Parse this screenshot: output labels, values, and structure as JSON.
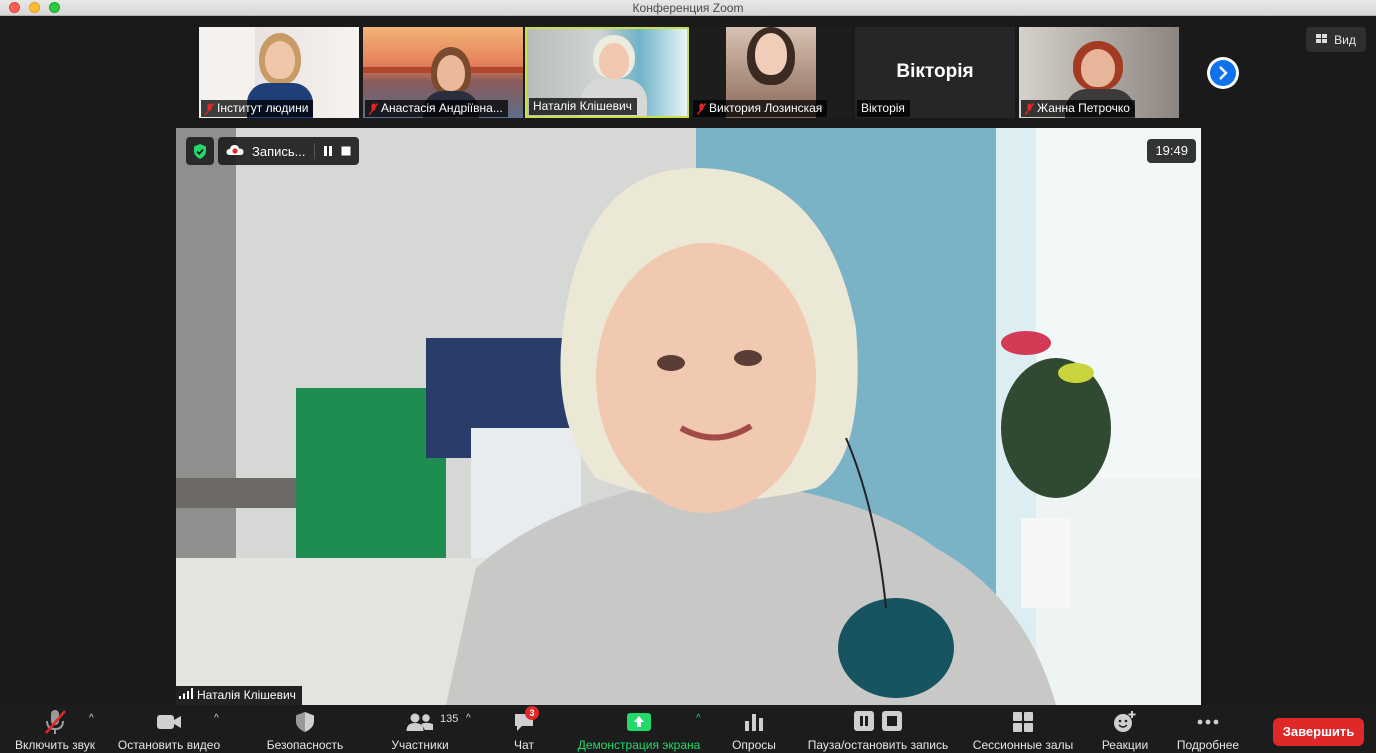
{
  "window": {
    "title": "Конференция Zoom"
  },
  "view_button": {
    "label": "Вид"
  },
  "participants_strip": [
    {
      "name": "Інститут людини",
      "muted": true
    },
    {
      "name": "Анастасія Андріївна...",
      "muted": true
    },
    {
      "name": "Наталія Клішевич",
      "muted": false,
      "active": true
    },
    {
      "name": "Виктория Лозинская",
      "muted": true
    },
    {
      "name": "Вікторія",
      "muted": false,
      "display_text": "Вікторія"
    },
    {
      "name": "Жанна Петрочко",
      "muted": true
    }
  ],
  "main_video": {
    "recording_label": "Запись...",
    "clock": "19:49",
    "speaker_name": "Наталія Клішевич"
  },
  "toolbar": {
    "audio_label": "Включить звук",
    "video_label": "Остановить видео",
    "security_label": "Безопасность",
    "participants_label": "Участники",
    "participants_count": "135",
    "chat_label": "Чат",
    "chat_badge": "3",
    "share_label": "Демонстрация экрана",
    "polls_label": "Опросы",
    "record_label": "Пауза/остановить запись",
    "breakout_label": "Сессионные залы",
    "reactions_label": "Реакции",
    "more_label": "Подробнее",
    "end_label": "Завершить"
  },
  "colors": {
    "accent_blue": "#0e72ed",
    "share_green": "#23d96a",
    "end_red": "#e02828",
    "active_tile_border": "#c8e04a"
  }
}
